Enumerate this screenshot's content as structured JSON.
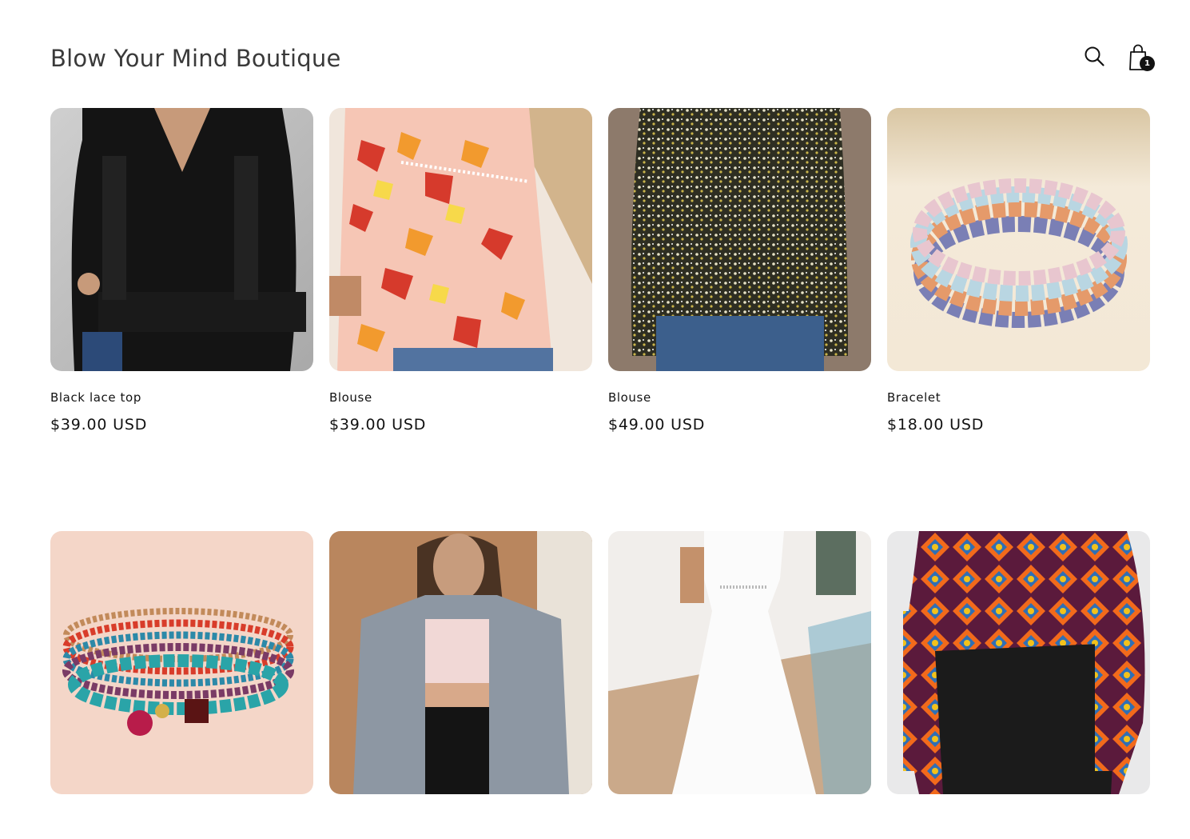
{
  "header": {
    "store_name": "Blow Your Mind Boutique",
    "search_icon": "search-icon",
    "cart_icon": "shopping-bag-icon",
    "cart_count": "1"
  },
  "products": [
    {
      "title": "Black lace top",
      "price": "$39.00 USD",
      "image": "black-lace-top-photo"
    },
    {
      "title": "Blouse",
      "price": "$39.00 USD",
      "image": "floral-blouse-photo"
    },
    {
      "title": "Blouse",
      "price": "$49.00 USD",
      "image": "ditsy-floral-blouse-photo"
    },
    {
      "title": "Bracelet",
      "price": "$18.00 USD",
      "image": "crystal-bead-bracelet-photo"
    },
    {
      "title": "",
      "price": "",
      "image": "beaded-bracelet-stack-photo"
    },
    {
      "title": "",
      "price": "",
      "image": "grey-cardigan-photo"
    },
    {
      "title": "",
      "price": "",
      "image": "white-maxi-dress-photo"
    },
    {
      "title": "",
      "price": "",
      "image": "aztec-hoodie-photo"
    }
  ]
}
